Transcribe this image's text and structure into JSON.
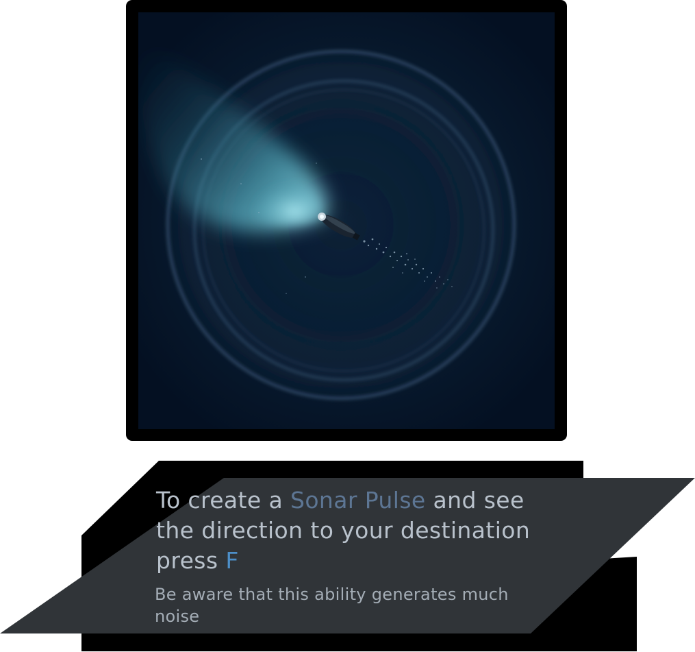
{
  "preview": {
    "scene": "sonar-pulse-demo",
    "background_color": "#061528",
    "beam_color": "#5fb8c9",
    "ring_color": "#3f5a74"
  },
  "tooltip": {
    "panel_color": "#303438",
    "shadow_color": "#000000",
    "line1_pre": "To create a ",
    "ability_name": "Sonar Pulse",
    "line1_post": " and see",
    "line2": "the direction to your destination",
    "line3_pre": "press ",
    "key": "F",
    "note": "Be aware that this ability generates much noise",
    "text_color": "#b9c2cc",
    "ability_color": "#5d7694",
    "key_color": "#4d8fc9"
  }
}
